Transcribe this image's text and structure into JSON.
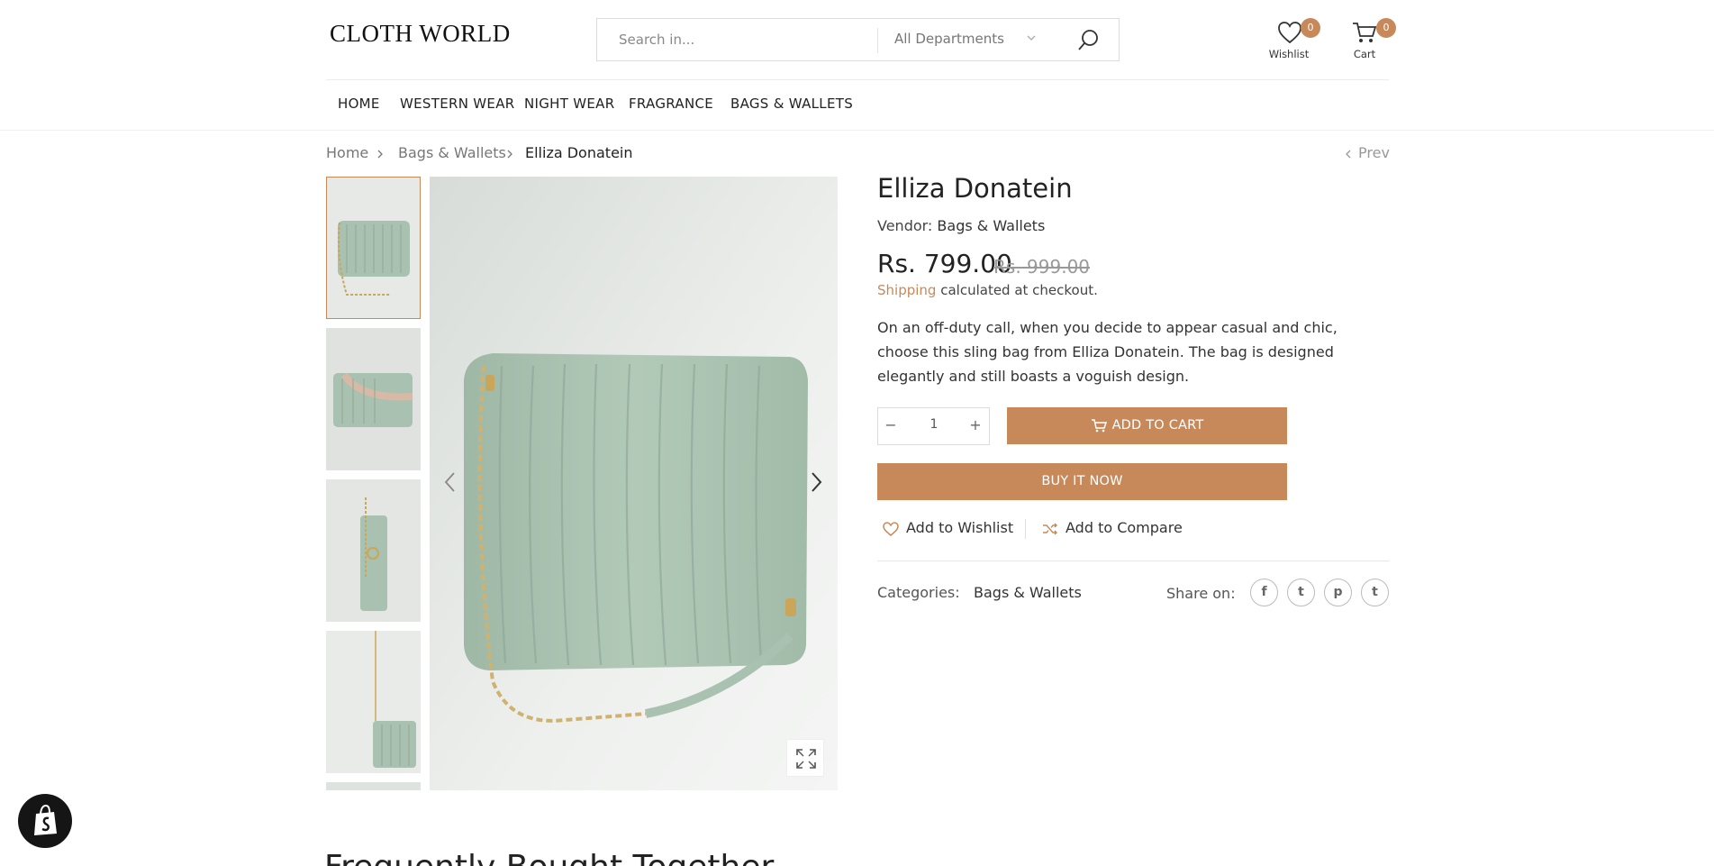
{
  "header": {
    "logo": "CLOTH WORLD",
    "search": {
      "placeholder": "Search in...",
      "department": "All Departments"
    },
    "wishlist": {
      "label": "Wishlist",
      "count": "0"
    },
    "cart": {
      "label": "Cart",
      "count": "0"
    }
  },
  "nav": {
    "items": [
      "HOME",
      "WESTERN WEAR",
      "NIGHT WEAR",
      "FRAGRANCE",
      "BAGS & WALLETS"
    ]
  },
  "breadcrumb": {
    "items": [
      "Home",
      "Bags & Wallets",
      "Elliza Donatein"
    ],
    "prev": "Prev"
  },
  "gallery": {
    "thumbnail_count": 5,
    "active_thumbnail": 1
  },
  "product": {
    "title": "Elliza Donatein",
    "vendor_label": "Vendor:",
    "vendor": "Bags & Wallets",
    "price": "Rs. 799.00",
    "compare_price": "Rs. 999.00",
    "shipping_link": "Shipping",
    "shipping_text": "calculated at checkout.",
    "description": "On an off-duty call, when you decide to appear casual and chic, choose this sling bag from Elliza Donatein. The bag is designed elegantly and still boasts a voguish design.",
    "quantity": "1",
    "add_to_cart": "ADD TO CART",
    "buy_now": "BUY IT NOW",
    "add_to_wishlist": "Add to Wishlist",
    "add_to_compare": "Add to Compare",
    "categories_label": "Categories:",
    "category": "Bags & Wallets",
    "share_label": "Share on:"
  },
  "icons": {
    "social": [
      "facebook-icon",
      "twitter-icon",
      "pinterest-icon",
      "tumblr-icon"
    ]
  },
  "social_glyphs": [
    "f",
    "t",
    "p",
    "t"
  ],
  "colors": {
    "accent": "#c8895a",
    "bag": "#a9c1b0"
  },
  "section": {
    "frequently_bought": "Frequently Bought Together"
  }
}
